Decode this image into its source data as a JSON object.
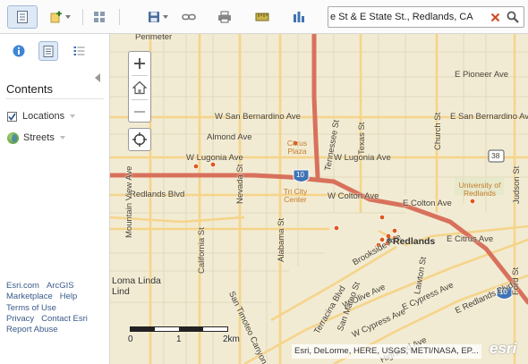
{
  "toolbar": {
    "buttons": [
      {
        "name": "map-layers-button",
        "icon": "page-list-icon"
      },
      {
        "name": "add-content-button",
        "icon": "add-icon"
      },
      {
        "name": "basemap-gallery-button",
        "icon": "grid-icon"
      },
      {
        "name": "save-button",
        "icon": "save-icon"
      },
      {
        "name": "share-link-button",
        "icon": "link-icon"
      },
      {
        "name": "print-button",
        "icon": "print-icon"
      },
      {
        "name": "measure-button",
        "icon": "measure-icon"
      },
      {
        "name": "bookmarks-button",
        "icon": "bookmark-icon"
      }
    ]
  },
  "search": {
    "value": "e St & E State St., Redlands, CA"
  },
  "panel": {
    "title": "Contents",
    "layers": [
      {
        "label": "Locations",
        "checked": true
      },
      {
        "label": "Streets"
      }
    ],
    "footer": [
      [
        "Esri.com",
        "ArcGIS"
      ],
      [
        "Marketplace",
        "Help"
      ],
      [
        "Terms of Use"
      ],
      [
        "Privacy",
        "Contact Esri"
      ],
      [
        "Report Abuse"
      ]
    ]
  },
  "map": {
    "labels": {
      "perimeter": "Perimeter",
      "e_pioneer": "E Pioneer Ave",
      "w_san_bernardino": "W San Bernardino Ave",
      "e_san_bernardino": "E San Bernardino Ave",
      "almond": "Almond Ave",
      "w_lugonia_left": "W Lugonia Ave",
      "w_lugonia_right": "W Lugonia Ave",
      "redlands_blvd": "Redlands Blvd",
      "w_colton": "W Colton Ave",
      "e_colton": "E Colton Ave",
      "e_citrus": "E Citrus Ave",
      "e_cypress": "E Cypress Ave",
      "e_redlands_blvd": "E Redlands Blvd",
      "w_olive": "W Olive Ave",
      "w_cypress": "W Cypress Ave",
      "highland": "Highland Ave",
      "brookside": "Brookside Ave",
      "mountain_view": "Mountain View Ave",
      "california": "California St",
      "nevada": "Nevada St",
      "alabama": "Alabama St",
      "tennessee": "Tennessee St",
      "texas": "Texas St",
      "church": "Church St",
      "ford": "Ford St",
      "judson": "Judson St",
      "lawton": "Lawton St",
      "san_mateo": "San Mateo St",
      "terracina": "Terracina Blvd",
      "san_timoteo": "San Timoteo Canyon Rd",
      "loma_linda": "Loma Linda",
      "redlands": "Redlands",
      "citrus_plaza": "Citrus Plaza",
      "tri_city": "Tri City Center",
      "univ": "University of Redlands",
      "shield_10_a": "10",
      "shield_10_b": "10",
      "shield_38": "38",
      "lind": "Lind"
    },
    "scale": {
      "zero": "0",
      "mid": "1",
      "end": "2km"
    },
    "attribution": "Esri, DeLorme, HERE, USGS, METI/NASA, EP...",
    "logo": "esri"
  },
  "colors": {
    "map_background": "#f2ebd3",
    "freeway": "#d8715c",
    "arterial": "#f5c56b",
    "location_point": "#e0581a"
  }
}
